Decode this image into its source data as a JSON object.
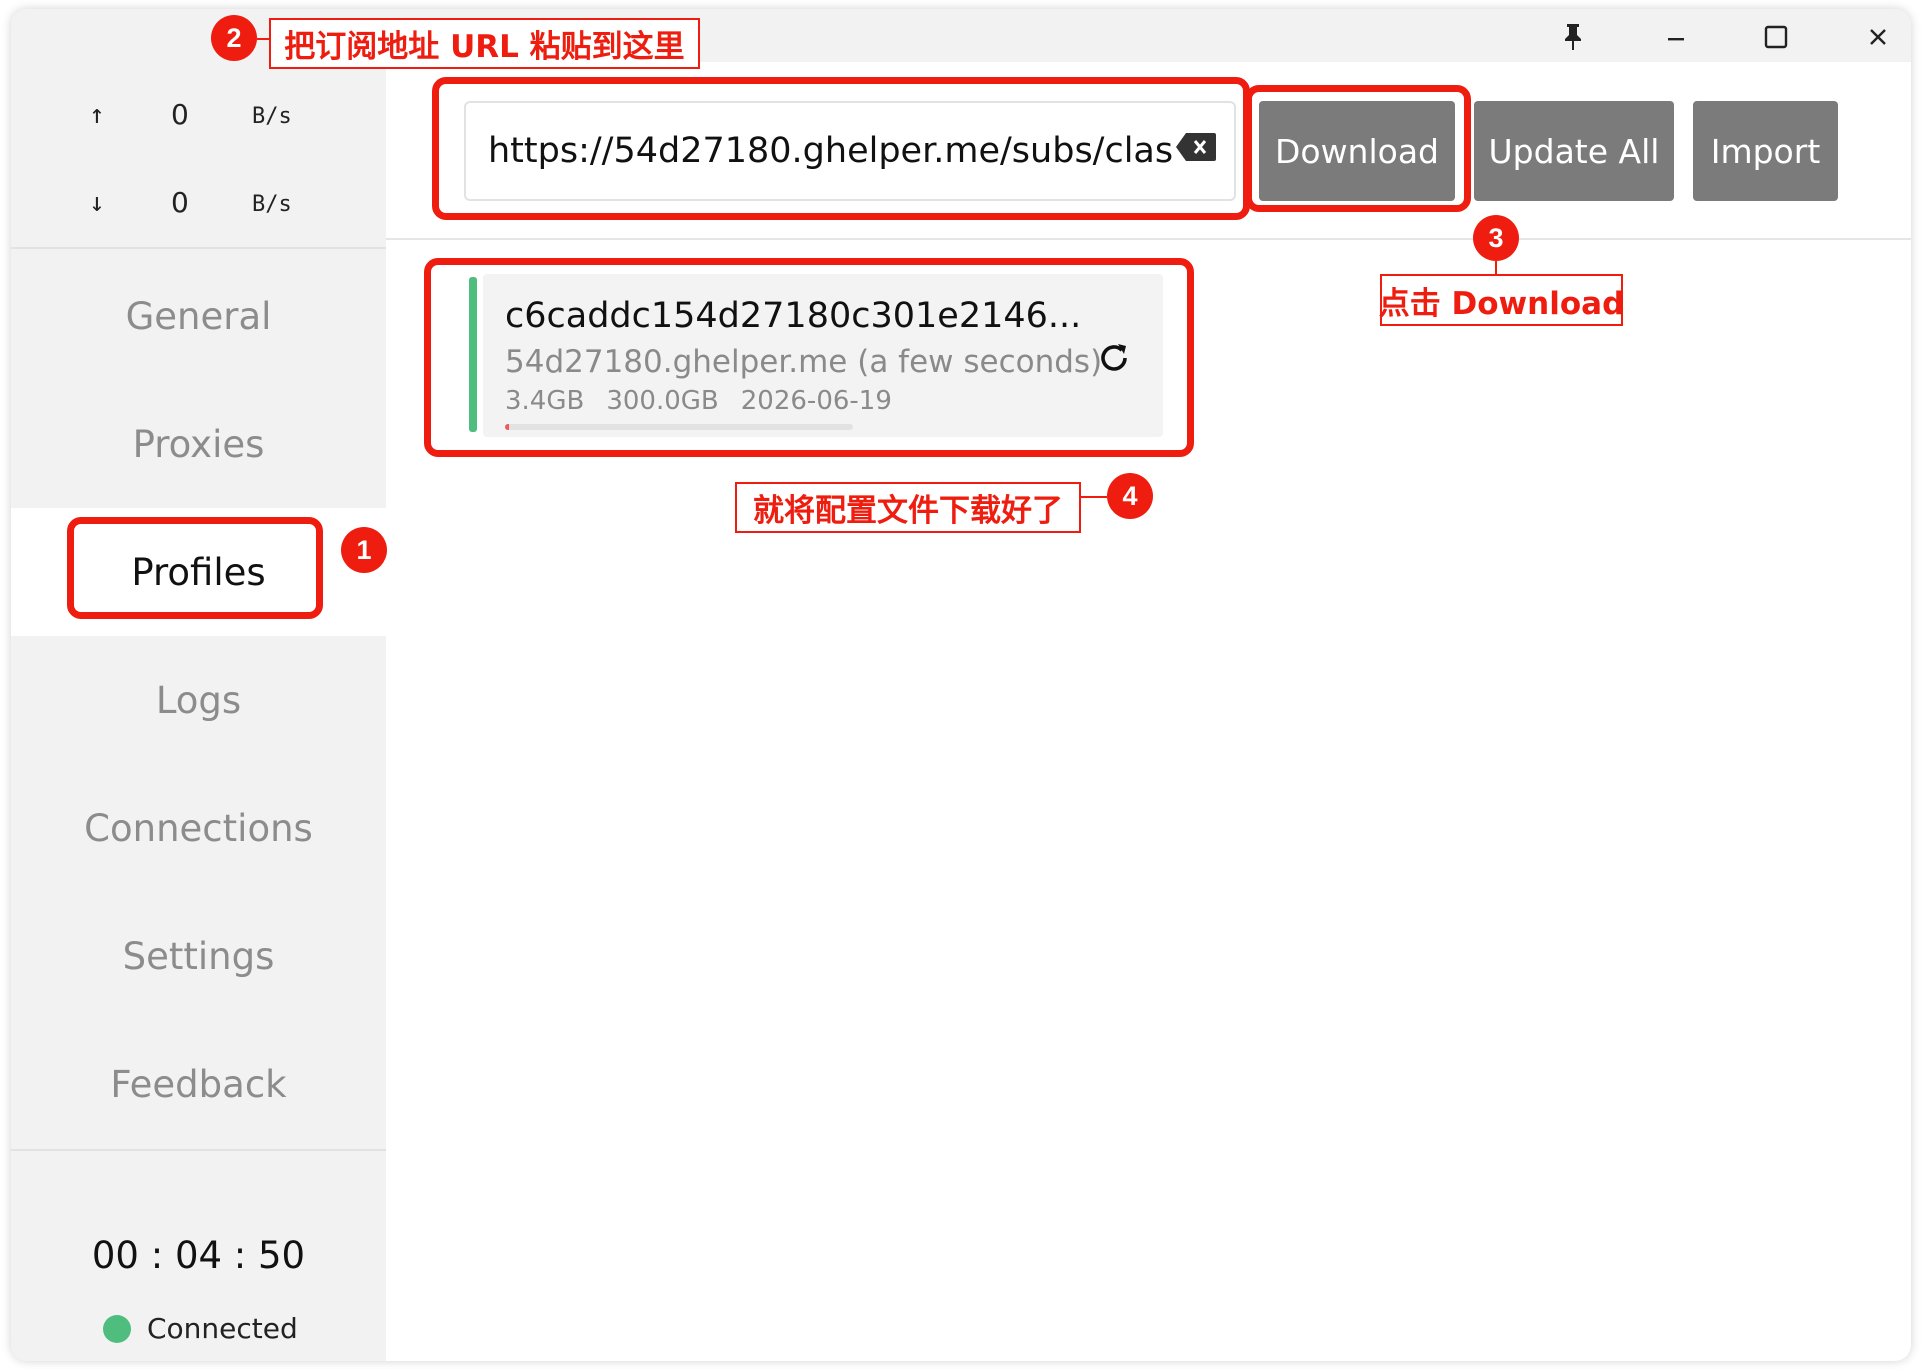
{
  "window": {
    "controls": {
      "pin_icon": "pin-icon",
      "minimize_icon": "minimize-icon",
      "maximize_icon": "maximize-icon",
      "close_icon": "close-icon"
    }
  },
  "traffic": {
    "upload": {
      "arrow": "↑",
      "value": "0",
      "unit": "B/s"
    },
    "download": {
      "arrow": "↓",
      "value": "0",
      "unit": "B/s"
    }
  },
  "sidebar": {
    "items": [
      {
        "label": "General"
      },
      {
        "label": "Proxies"
      },
      {
        "label": "Profiles",
        "active": true
      },
      {
        "label": "Logs"
      },
      {
        "label": "Connections"
      },
      {
        "label": "Settings"
      },
      {
        "label": "Feedback"
      }
    ],
    "timer": "00 : 04 : 50",
    "status": "Connected"
  },
  "toolbar": {
    "url_value": "https://54d27180.ghelper.me/subs/clas",
    "download_label": "Download",
    "update_all_label": "Update All",
    "import_label": "Import"
  },
  "profile": {
    "title": "c6caddc154d27180c301e2146...",
    "host": "54d27180.ghelper.me (a few seconds)",
    "used": "3.4GB",
    "total": "300.0GB",
    "expire": "2026-06-19",
    "usage_fraction": 0.011
  },
  "annotations": {
    "step1": {
      "number": "1"
    },
    "step2": {
      "number": "2",
      "text": "把订阅地址 URL 粘贴到这里"
    },
    "step3": {
      "number": "3",
      "text": "点击 Download"
    },
    "step4": {
      "number": "4",
      "text": "就将配置文件下载好了"
    }
  },
  "colors": {
    "accent_red": "#ee1d0f",
    "connected_green": "#4fbd7e",
    "button_gray": "#7b7b7b"
  }
}
